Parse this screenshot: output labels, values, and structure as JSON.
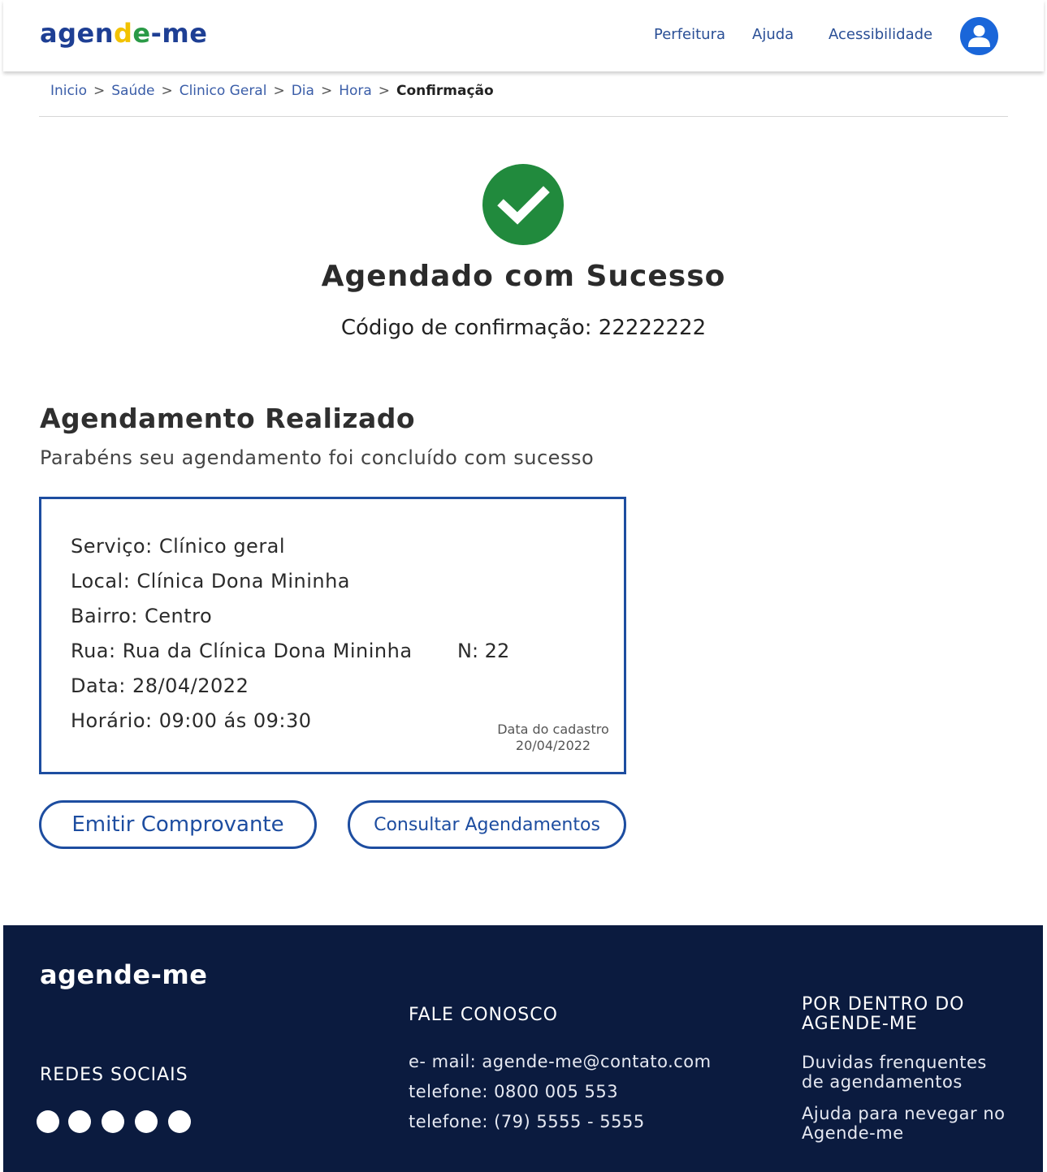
{
  "header": {
    "logo": {
      "part1": "agen",
      "part2": "d",
      "part3": "e",
      "part4": "-me"
    },
    "nav": [
      "Perfeitura",
      "Ajuda",
      "Acessibilidade"
    ],
    "avatar_icon": "user-icon"
  },
  "breadcrumb": {
    "items": [
      "Inicio",
      "Saúde",
      "Clinico Geral",
      "Dia",
      "Hora"
    ],
    "separator": ">",
    "current": "Confirmação"
  },
  "success": {
    "icon": "check-icon",
    "title": "Agendado com Sucesso",
    "code": "Código de confirmação: 22222222"
  },
  "agendamento": {
    "title": "Agendamento Realizado",
    "subtitle": "Parabéns seu agendamento foi concluído com sucesso",
    "details": {
      "servico": "Serviço: Clínico geral",
      "local": "Local: Clínica Dona Mininha",
      "bairro": "Bairro: Centro",
      "rua": "Rua: Rua da Clínica Dona Mininha",
      "numero": "N: 22",
      "data": "Data: 28/04/2022",
      "horario": "Horário:  09:00 ás 09:30",
      "cadastro_label": "Data do cadastro",
      "cadastro_date": "20/04/2022"
    }
  },
  "buttons": {
    "emitir": "Emitir Comprovante",
    "consultar": "Consultar Agendamentos"
  },
  "footer": {
    "logo": "agende-me",
    "redes": "REDES SOCIAIS",
    "fale": "FALE CONOSCO",
    "email": "e- mail: agende-me@contato.com",
    "telefone1": "telefone: 0800 005 553",
    "telefone2": "telefone: (79) 5555 - 5555",
    "por_dentro": "POR DENTRO DO AGENDE-ME",
    "link1": "Duvidas frenquentes de agendamentos",
    "link2": "Ajuda para nevegar no Agende-me"
  },
  "colors": {
    "primary": "#1d4da0",
    "success": "#218a3d",
    "footer_bg": "#0b1b3f",
    "avatar": "#1a66d9"
  }
}
